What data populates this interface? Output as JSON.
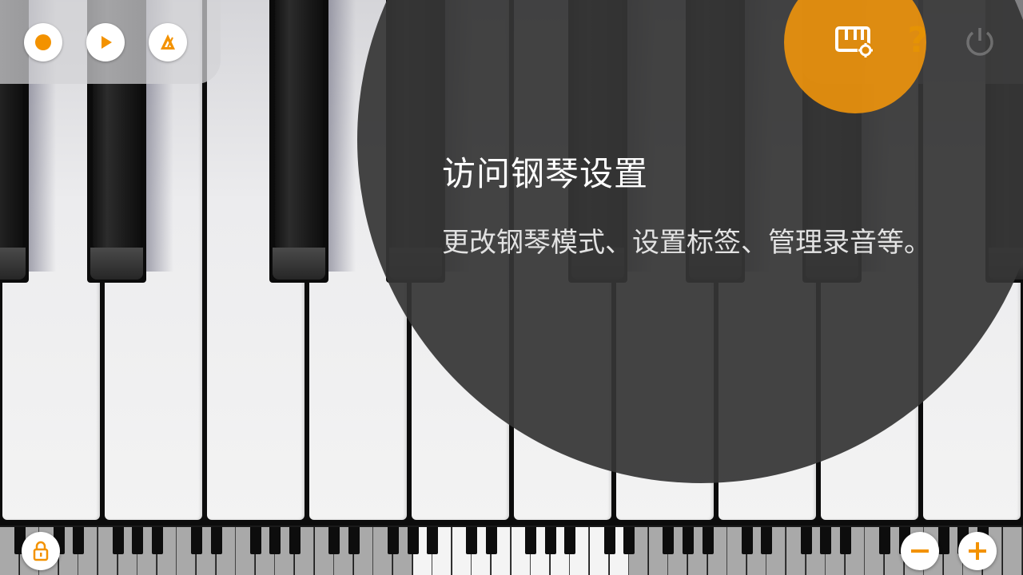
{
  "toolbar": {
    "record_icon": "record-icon",
    "play_icon": "play-icon",
    "metronome_icon": "metronome-icon"
  },
  "top_right": {
    "piano_settings_icon": "piano-settings-icon",
    "help_label": "?",
    "power_icon": "power-icon"
  },
  "coach_mark": {
    "title": "访问钢琴设置",
    "description": "更改钢琴模式、设置标签、管理录音等。"
  },
  "bottom_controls": {
    "lock_icon": "lock-icon",
    "zoom_out_icon": "minus-icon",
    "zoom_in_icon": "plus-icon"
  },
  "colors": {
    "accent": "#F39200",
    "overlay": "#363636",
    "white_key": "#EDEDED",
    "black_key": "#0B0B0B"
  }
}
